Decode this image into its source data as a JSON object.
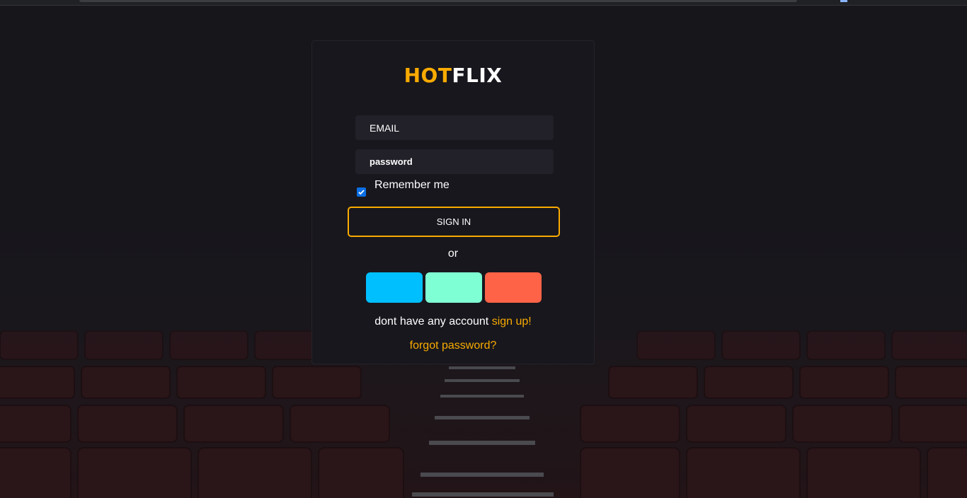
{
  "brand": {
    "part1": "HOT",
    "part2": "FLIX"
  },
  "form": {
    "email_placeholder": "EMAIL",
    "password_placeholder": "password",
    "remember_label": "Remember me",
    "remember_checked": true,
    "signin_label": "SIGN IN",
    "or_text": "or"
  },
  "social_buttons": [
    {
      "color": "#00bfff"
    },
    {
      "color": "#7fffd4"
    },
    {
      "color": "#ff6347"
    }
  ],
  "footer": {
    "no_account_text": "dont have any account",
    "signup_link": "sign up!",
    "forgot_link": "forgot password?"
  },
  "colors": {
    "accent": "#f9ab00",
    "background": "#141318",
    "card": "#18171d",
    "input": "#222129"
  }
}
